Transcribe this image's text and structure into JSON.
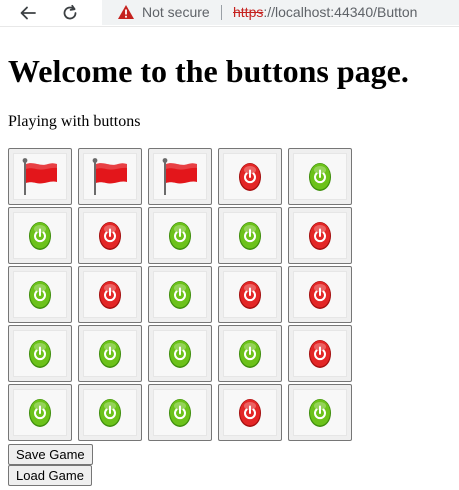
{
  "browser": {
    "security_label": "Not secure",
    "url_scheme": "https",
    "url_rest": "://localhost:44340/Button",
    "icons": {
      "back": "arrow-left-icon",
      "reload": "reload-icon",
      "warning": "warning-triangle-icon"
    },
    "warning_color": "#c5221f"
  },
  "page": {
    "title": "Welcome to the buttons page.",
    "subtitle": "Playing with buttons"
  },
  "board": {
    "rows": 5,
    "cols": 5,
    "cells": [
      [
        "flag",
        "flag",
        "flag",
        "red",
        "green"
      ],
      [
        "green",
        "red",
        "green",
        "green",
        "red"
      ],
      [
        "green",
        "red",
        "green",
        "red",
        "red"
      ],
      [
        "green",
        "green",
        "green",
        "green",
        "red"
      ],
      [
        "green",
        "green",
        "green",
        "red",
        "green"
      ]
    ],
    "colors": {
      "green": "#6cc21a",
      "green_dark": "#3f8f0c",
      "red": "#e32626",
      "red_dark": "#a50f0f",
      "flag": "#e3161b",
      "flag_pole": "#6b6b6b"
    }
  },
  "actions": {
    "save_label": "Save Game",
    "load_label": "Load Game"
  }
}
